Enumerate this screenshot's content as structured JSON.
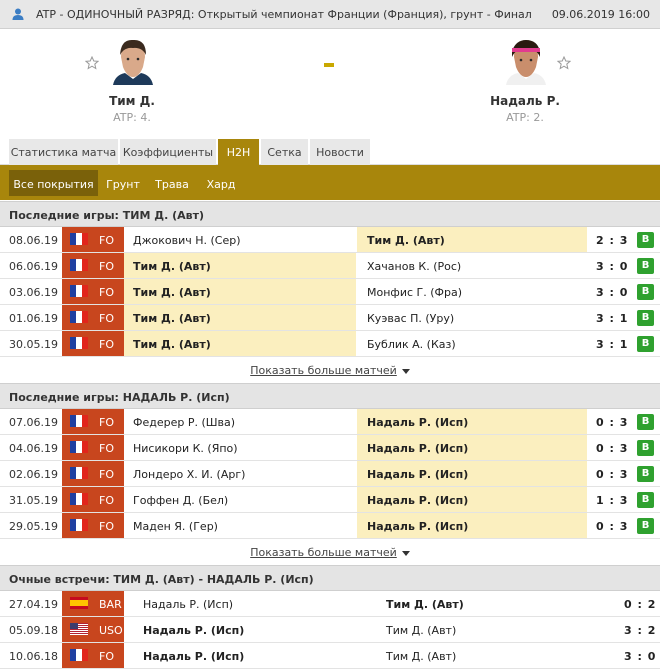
{
  "topbar": {
    "title": "ATP - ОДИНОЧНЫЙ РАЗРЯД: Открытый чемпионат Франции (Франция), грунт - Финал",
    "date": "09.06.2019 16:00",
    "icon": "user-icon"
  },
  "match": {
    "home": {
      "name": "Тим Д.",
      "rank": "ATP: 4."
    },
    "away": {
      "name": "Надаль Р.",
      "rank": "ATP: 2."
    },
    "score_separator": "-"
  },
  "tabs": [
    {
      "label": "Статистика матча",
      "active": false
    },
    {
      "label": "Коэффициенты",
      "active": false
    },
    {
      "label": "H2H",
      "active": true
    },
    {
      "label": "Сетка",
      "active": false
    },
    {
      "label": "Новости",
      "active": false
    }
  ],
  "subtabs": [
    {
      "label": "Все покрытия",
      "active": true
    },
    {
      "label": "Грунт",
      "active": false
    },
    {
      "label": "Трава",
      "active": false
    },
    {
      "label": "Хард",
      "active": false
    }
  ],
  "colors": {
    "accent": "#a8860c",
    "win": "#2fa12f",
    "tournament": "#c8461e",
    "highlight": "#fbefbf"
  },
  "sections": [
    {
      "title": "Последние игры: ТИМ Д. (Авт)",
      "more_label": "Показать больше матчей",
      "rows": [
        {
          "date": "08.06.19",
          "flag": "fr",
          "tour": "FO",
          "home": "Джокович Н. (Сер)",
          "away": "Тим Д. (Авт)",
          "bold": "away",
          "score": "2 : 3",
          "result": "В"
        },
        {
          "date": "06.06.19",
          "flag": "fr",
          "tour": "FO",
          "home": "Тим Д. (Авт)",
          "away": "Хачанов К. (Рос)",
          "bold": "home",
          "score": "3 : 0",
          "result": "В"
        },
        {
          "date": "03.06.19",
          "flag": "fr",
          "tour": "FO",
          "home": "Тим Д. (Авт)",
          "away": "Монфис Г. (Фра)",
          "bold": "home",
          "score": "3 : 0",
          "result": "В"
        },
        {
          "date": "01.06.19",
          "flag": "fr",
          "tour": "FO",
          "home": "Тим Д. (Авт)",
          "away": "Куэвас П. (Уру)",
          "bold": "home",
          "score": "3 : 1",
          "result": "В"
        },
        {
          "date": "30.05.19",
          "flag": "fr",
          "tour": "FO",
          "home": "Тим Д. (Авт)",
          "away": "Бублик А. (Каз)",
          "bold": "home",
          "score": "3 : 1",
          "result": "В"
        }
      ]
    },
    {
      "title": "Последние игры: НАДАЛЬ Р. (Исп)",
      "more_label": "Показать больше матчей",
      "rows": [
        {
          "date": "07.06.19",
          "flag": "fr",
          "tour": "FO",
          "home": "Федерер Р. (Шва)",
          "away": "Надаль Р. (Исп)",
          "bold": "away",
          "score": "0 : 3",
          "result": "В"
        },
        {
          "date": "04.06.19",
          "flag": "fr",
          "tour": "FO",
          "home": "Нисикори К. (Япо)",
          "away": "Надаль Р. (Исп)",
          "bold": "away",
          "score": "0 : 3",
          "result": "В"
        },
        {
          "date": "02.06.19",
          "flag": "fr",
          "tour": "FO",
          "home": "Лондеро Х. И. (Арг)",
          "away": "Надаль Р. (Исп)",
          "bold": "away",
          "score": "0 : 3",
          "result": "В"
        },
        {
          "date": "31.05.19",
          "flag": "fr",
          "tour": "FO",
          "home": "Гоффен Д. (Бел)",
          "away": "Надаль Р. (Исп)",
          "bold": "away",
          "score": "1 : 3",
          "result": "В"
        },
        {
          "date": "29.05.19",
          "flag": "fr",
          "tour": "FO",
          "home": "Маден Я. (Гер)",
          "away": "Надаль Р. (Исп)",
          "bold": "away",
          "score": "0 : 3",
          "result": "В"
        }
      ]
    },
    {
      "title": "Очные встречи: ТИМ Д. (Авт) - НАДАЛЬ Р. (Исп)",
      "rows": [
        {
          "date": "27.04.19",
          "flag": "es",
          "tour": "BAR",
          "home": "Надаль Р. (Исп)",
          "away": "Тим Д. (Авт)",
          "bold": "away",
          "score": "0 : 2",
          "result": ""
        },
        {
          "date": "05.09.18",
          "flag": "us",
          "tour": "USO",
          "home": "Надаль Р. (Исп)",
          "away": "Тим Д. (Авт)",
          "bold": "home",
          "score": "3 : 2",
          "result": ""
        },
        {
          "date": "10.06.18",
          "flag": "fr",
          "tour": "FO",
          "home": "Надаль Р. (Исп)",
          "away": "Тим Д. (Авт)",
          "bold": "home",
          "score": "3 : 0",
          "result": ""
        }
      ]
    }
  ]
}
